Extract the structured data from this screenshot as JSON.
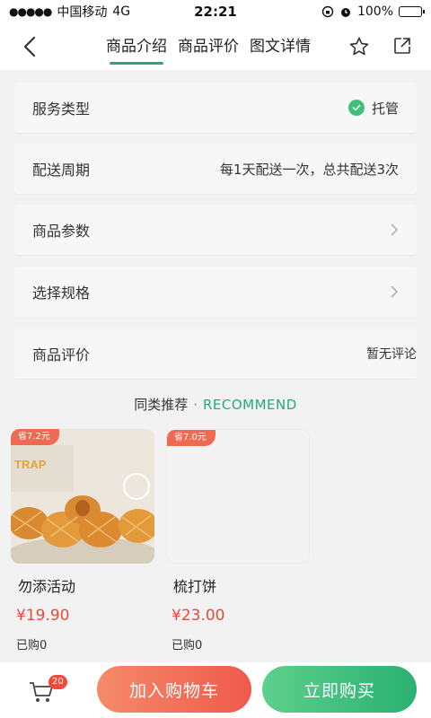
{
  "status_bar": {
    "carrier": "中国移动",
    "network": "4G",
    "time": "22:21",
    "battery": "100%",
    "battery_level": 1.0
  },
  "nav": {
    "tabs": [
      {
        "label": "商品介绍",
        "active": true
      },
      {
        "label": "商品评价",
        "active": false
      },
      {
        "label": "图文详情",
        "active": false
      }
    ],
    "icons": [
      "back-icon",
      "star-icon",
      "share-icon"
    ]
  },
  "rows": [
    {
      "label": "服务类型",
      "value": "托管"
    },
    {
      "label": "配送周期",
      "value": "每1天配送一次，总共配送3次"
    },
    {
      "label": "商品参数",
      "value": ""
    },
    {
      "label": "选择规格",
      "value": ""
    },
    {
      "label": "商品评价",
      "value": "暂无评论"
    }
  ],
  "recommend": {
    "title_cn": "同类推荐",
    "title_en": "RECOMMEND",
    "items": [
      {
        "badge": "省7.2元",
        "name": "勿添活动",
        "price": "¥19.90",
        "sold": "已购0",
        "image_text": "TRAP"
      },
      {
        "badge": "省7.0元",
        "name": "梳打饼",
        "price": "¥23.00",
        "sold": "已购0"
      }
    ]
  },
  "bottom": {
    "cart_count": "20",
    "add_to_cart": "加入购物车",
    "buy_now": "立即购买"
  },
  "colors": {
    "accent_green": "#2aa876",
    "price_red": "#e64b3b",
    "cart_btn": "#ef5a4c",
    "buy_btn": "#2ab071"
  }
}
